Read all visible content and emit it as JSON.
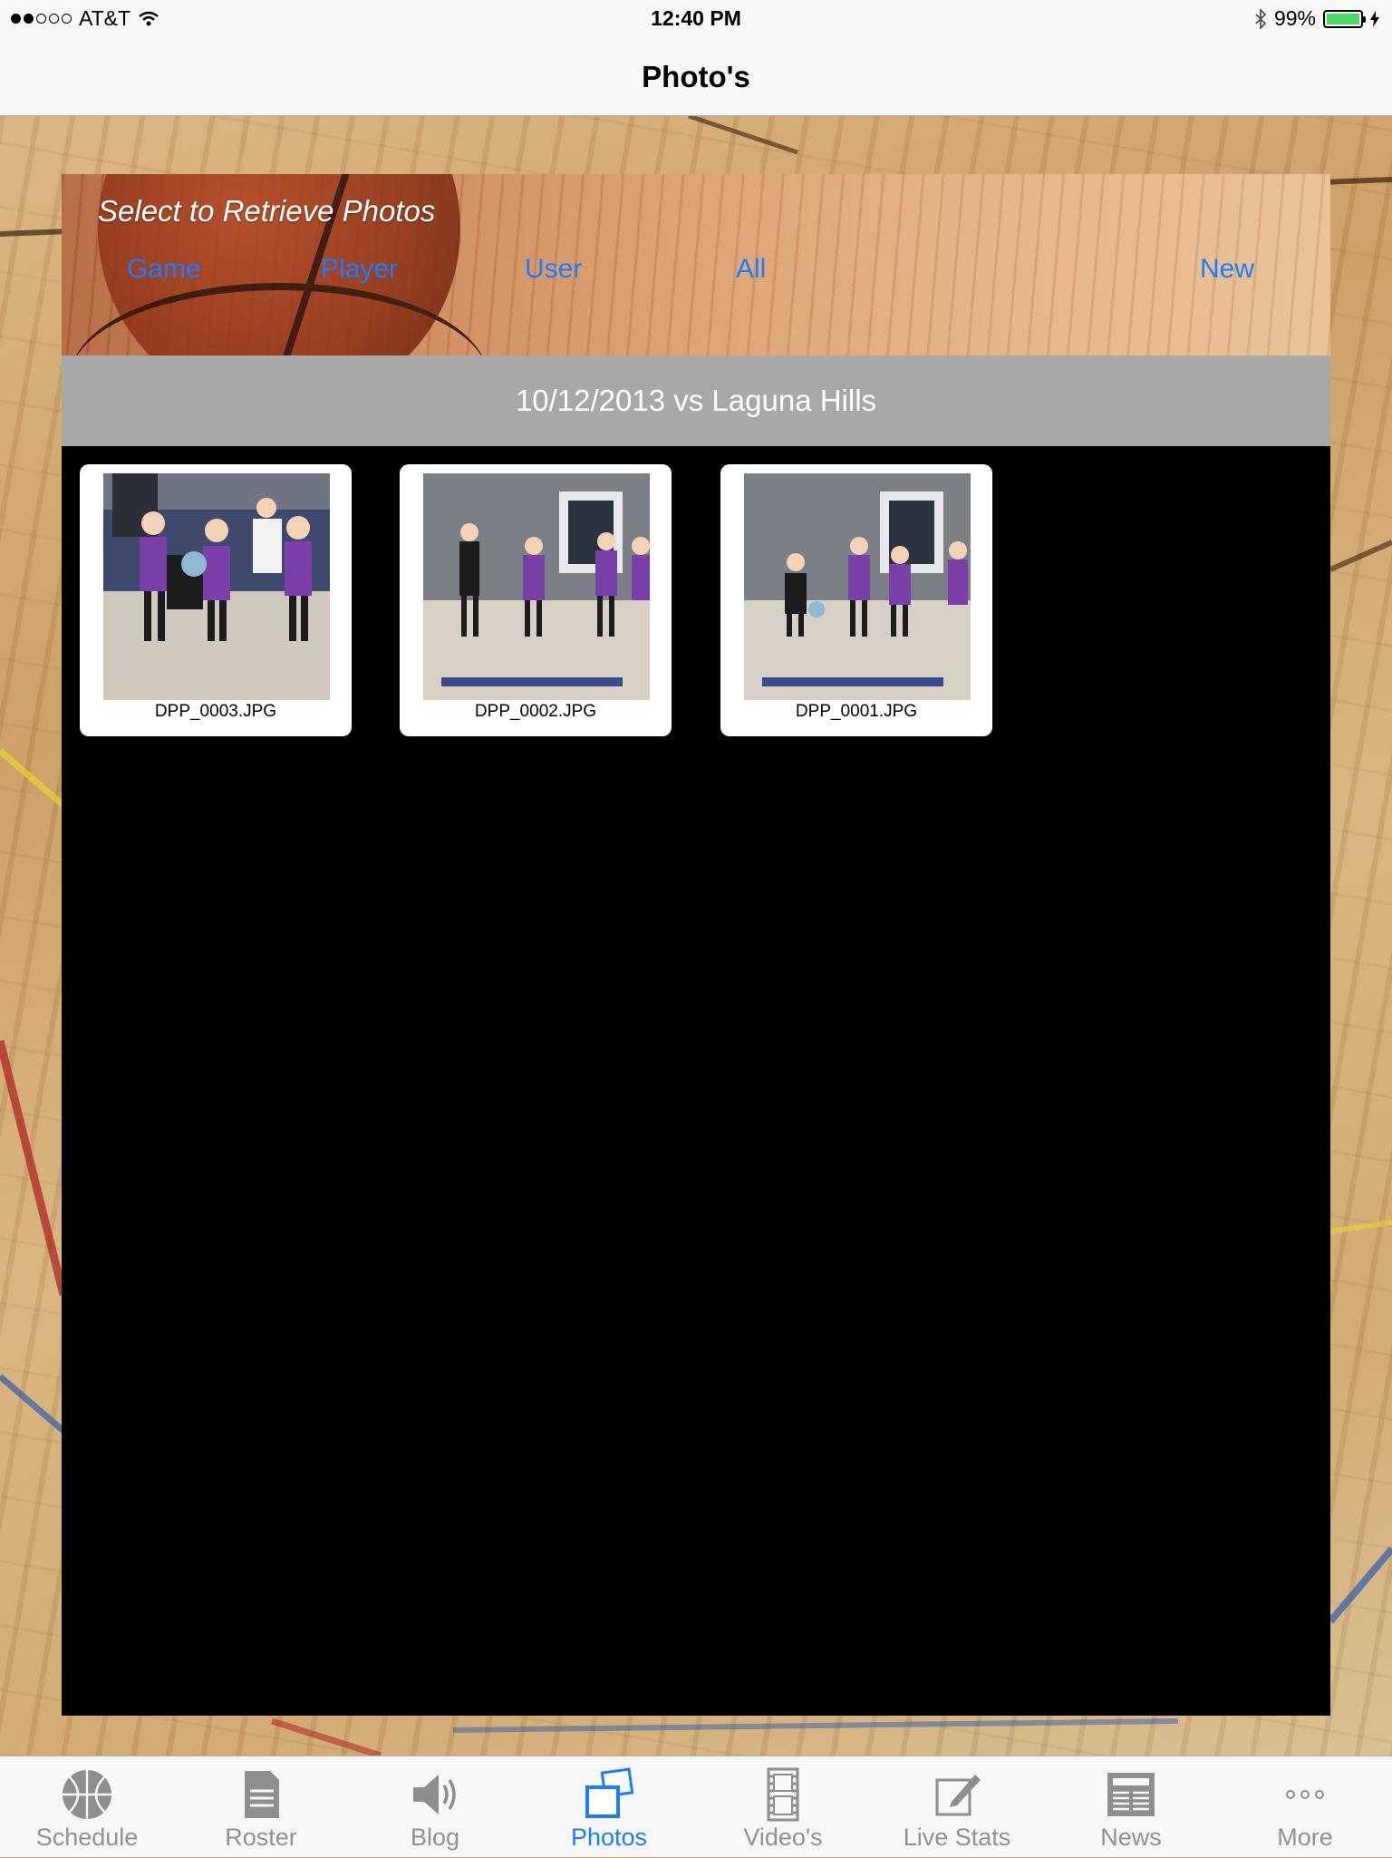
{
  "status_bar": {
    "carrier": "AT&T",
    "signal_bars_filled": 2,
    "signal_bars_total": 5,
    "time": "12:40 PM",
    "battery_percent": "99%",
    "battery_level": 0.99
  },
  "nav": {
    "title": "Photo's"
  },
  "filters": {
    "prompt": "Select to Retrieve Photos",
    "items": [
      {
        "label": "Game"
      },
      {
        "label": "Player"
      },
      {
        "label": "User"
      },
      {
        "label": "All"
      },
      {
        "label": "New"
      }
    ]
  },
  "game": {
    "title": "10/12/2013 vs Laguna Hills"
  },
  "photos": [
    {
      "filename": "DPP_0003.JPG"
    },
    {
      "filename": "DPP_0002.JPG"
    },
    {
      "filename": "DPP_0001.JPG"
    }
  ],
  "tabs": [
    {
      "label": "Schedule",
      "icon": "basketball-icon"
    },
    {
      "label": "Roster",
      "icon": "document-icon"
    },
    {
      "label": "Blog",
      "icon": "speaker-icon"
    },
    {
      "label": "Photos",
      "icon": "photos-icon",
      "active": true
    },
    {
      "label": "Video's",
      "icon": "film-icon"
    },
    {
      "label": "Live Stats",
      "icon": "edit-icon"
    },
    {
      "label": "News",
      "icon": "newspaper-icon"
    },
    {
      "label": "More",
      "icon": "more-icon"
    }
  ],
  "colors": {
    "accent": "#1a7dff",
    "tab_inactive": "#929292",
    "game_bar": "#a8a8a8",
    "panel": "#000000"
  }
}
